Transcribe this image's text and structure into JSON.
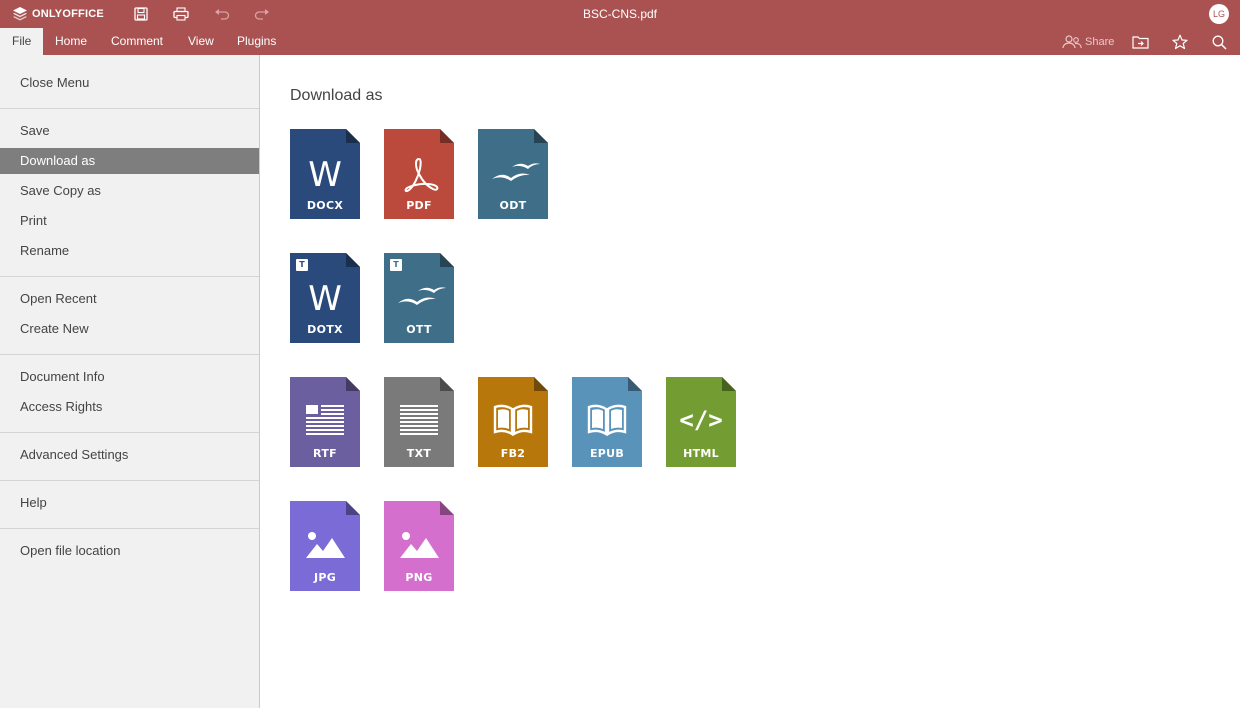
{
  "app": {
    "brand": "ONLYOFFICE",
    "document_title": "BSC-CNS.pdf",
    "user_initials": "LG"
  },
  "colors": {
    "header": "#aa5252",
    "menu_bg": "#f1f1f1",
    "menu_selected": "#7e7e7e"
  },
  "toolbar": {
    "icons": [
      "save-icon",
      "print-icon",
      "undo-icon",
      "redo-icon"
    ]
  },
  "menubar": {
    "tabs": [
      {
        "label": "File",
        "active": true
      },
      {
        "label": "Home",
        "active": false
      },
      {
        "label": "Comment",
        "active": false
      },
      {
        "label": "View",
        "active": false
      },
      {
        "label": "Plugins",
        "active": false
      }
    ],
    "share_label": "Share"
  },
  "file_menu": {
    "items": [
      {
        "label": "Close Menu"
      },
      {
        "label": "Save"
      },
      {
        "label": "Download as",
        "selected": true
      },
      {
        "label": "Save Copy as"
      },
      {
        "label": "Print"
      },
      {
        "label": "Rename"
      },
      {
        "label": "Open Recent"
      },
      {
        "label": "Create New"
      },
      {
        "label": "Document Info"
      },
      {
        "label": "Access Rights"
      },
      {
        "label": "Advanced Settings"
      },
      {
        "label": "Help"
      },
      {
        "label": "Open file location"
      }
    ]
  },
  "main": {
    "heading": "Download as",
    "formats": [
      {
        "label": "DOCX",
        "color": "#2a4a7c",
        "icon": "word-icon",
        "template": false
      },
      {
        "label": "PDF",
        "color": "#bb4a3c",
        "icon": "acrobat-icon",
        "template": false
      },
      {
        "label": "ODT",
        "color": "#3e6e88",
        "icon": "gulls-icon",
        "template": false
      },
      {
        "label": "DOTX",
        "color": "#2a4a7c",
        "icon": "word-icon",
        "template": true
      },
      {
        "label": "OTT",
        "color": "#3e6e88",
        "icon": "gulls-icon",
        "template": true
      },
      {
        "label": "RTF",
        "color": "#6c5fa0",
        "icon": "rtf-icon",
        "template": false
      },
      {
        "label": "TXT",
        "color": "#7a7a7a",
        "icon": "txt-icon",
        "template": false
      },
      {
        "label": "FB2",
        "color": "#b8770b",
        "icon": "book-icon",
        "template": false
      },
      {
        "label": "EPUB",
        "color": "#5a93ba",
        "icon": "book-icon",
        "template": false
      },
      {
        "label": "HTML",
        "color": "#739c32",
        "icon": "code-icon",
        "template": false
      },
      {
        "label": "JPG",
        "color": "#7a6bd6",
        "icon": "image-icon",
        "template": false
      },
      {
        "label": "PNG",
        "color": "#d56fce",
        "icon": "image-icon",
        "template": false
      }
    ],
    "template_badge": "T"
  }
}
